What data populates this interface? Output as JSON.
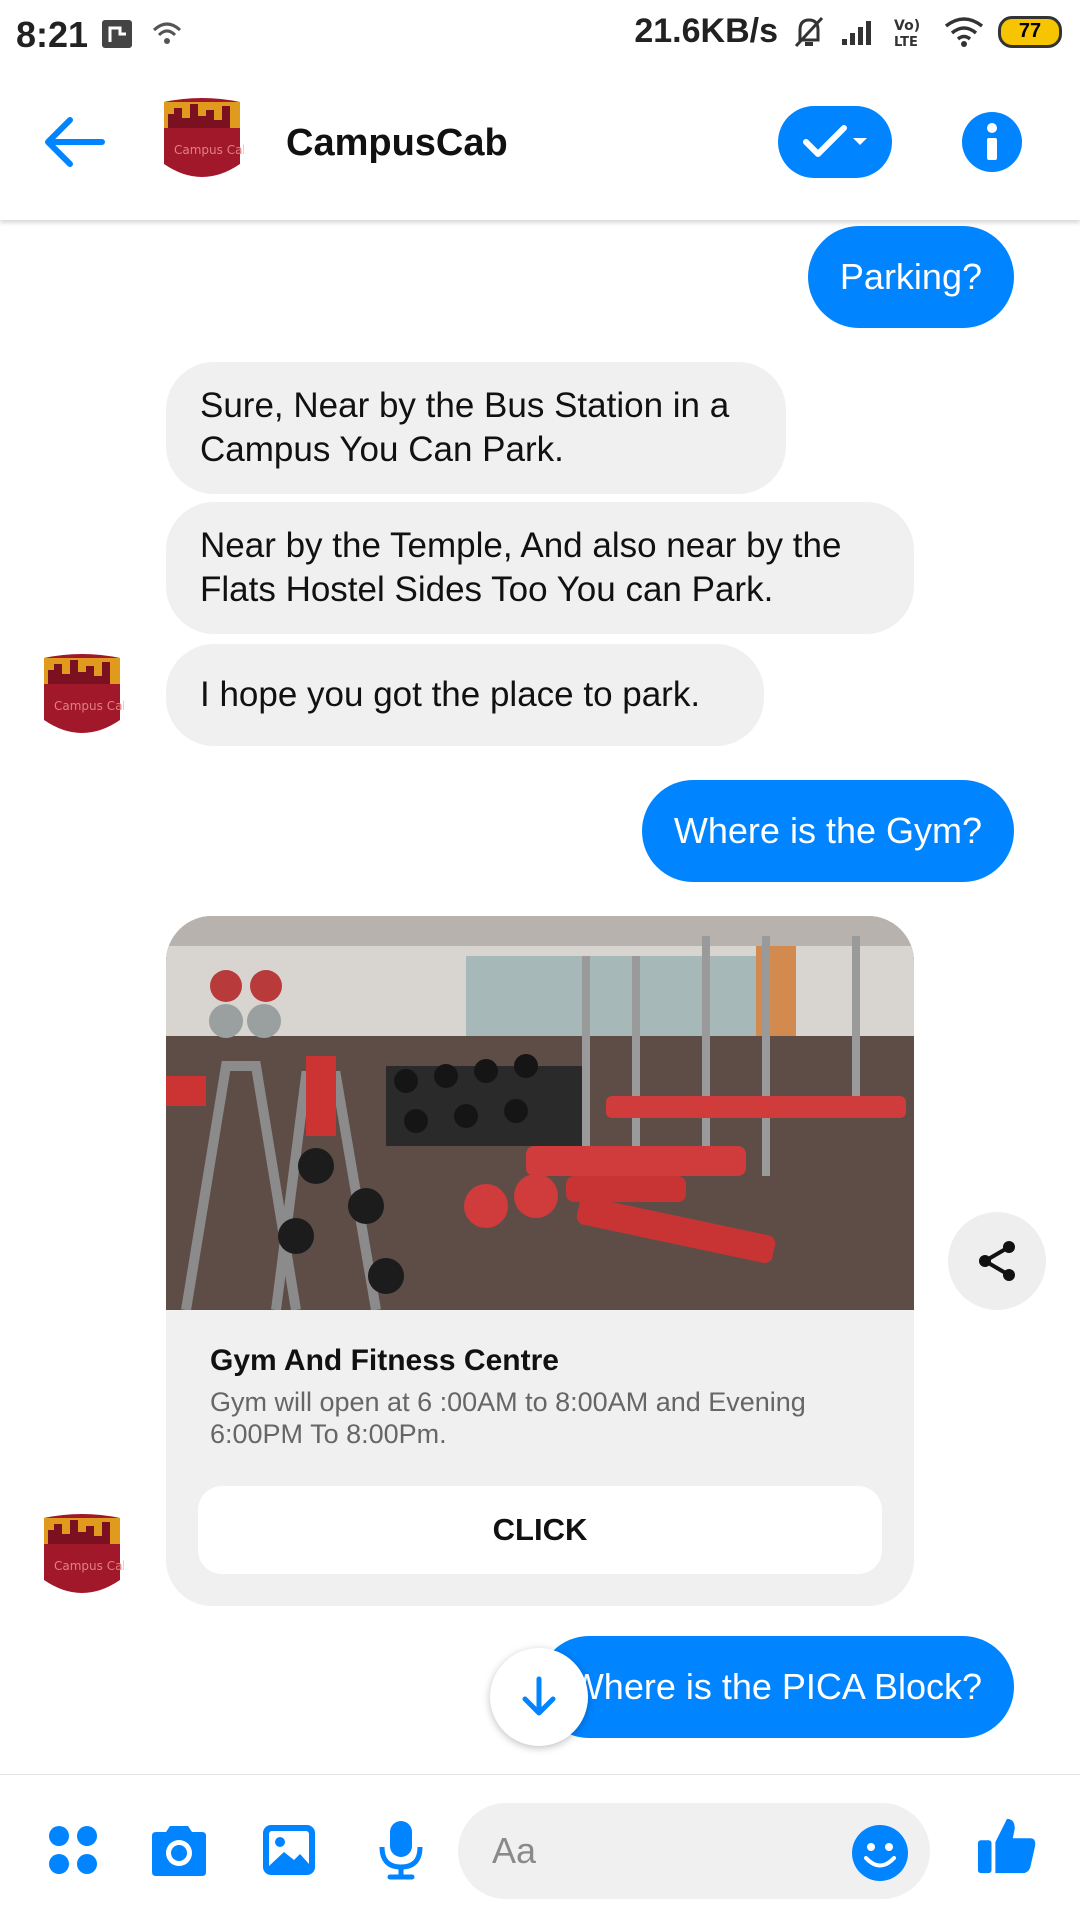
{
  "status_bar": {
    "time": "8:21",
    "speed": "21.6KB/s",
    "network": "Vo) LTE",
    "battery": "77"
  },
  "header": {
    "title": "CampusCab",
    "avatar_text": "Campus Cab"
  },
  "messages": {
    "out_1": "Parking?",
    "in_1": "Sure, Near by the Bus Station in a Campus You Can Park.",
    "in_2": "Near by the Temple, And also near by the Flats Hostel Sides Too You can Park.",
    "in_3": "I hope you got the place to park.",
    "out_2": "Where is the Gym?",
    "out_3": "Where is the PICA Block?"
  },
  "card": {
    "title": "Gym And Fitness Centre",
    "subtitle": "Gym will open at 6 :00AM to 8:00AM and Evening 6:00PM To 8:00Pm.",
    "button_label": "CLICK"
  },
  "composer": {
    "placeholder": "Aa"
  },
  "colors": {
    "accent": "#0084ff",
    "incoming_bubble": "#f0f0f0",
    "avatar_red": "#a0182a",
    "avatar_orange": "#e09a1e"
  }
}
